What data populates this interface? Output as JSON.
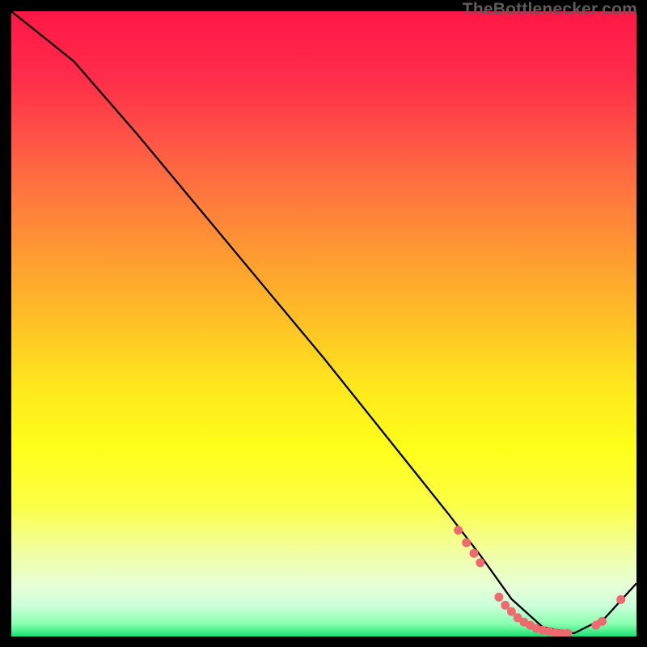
{
  "watermark": "TheBottlenecker.com",
  "chart_data": {
    "type": "line",
    "title": "",
    "xlabel": "",
    "ylabel": "",
    "xlim": [
      0,
      100
    ],
    "ylim": [
      0,
      100
    ],
    "series": [
      {
        "name": "bottleneck-curve",
        "x": [
          0,
          5,
          10,
          20,
          30,
          40,
          50,
          60,
          70,
          75,
          80,
          85,
          90,
          95,
          100
        ],
        "y": [
          100,
          96,
          92,
          80.5,
          68.5,
          56.5,
          44.5,
          32,
          19.5,
          13,
          6,
          1.5,
          0.5,
          3,
          8.5
        ]
      }
    ],
    "markers": {
      "name": "highlight-dots",
      "color": "#ee6a6e",
      "x": [
        71.5,
        72.8,
        74.0,
        75.0,
        78.0,
        79.0,
        80.0,
        81.0,
        82.0,
        83.0,
        84.0,
        85.0,
        86.0,
        87.0,
        88.0,
        89.0,
        93.5,
        94.5,
        97.5
      ],
      "y": [
        17.0,
        15.0,
        13.3,
        11.8,
        6.3,
        5.0,
        4.0,
        3.0,
        2.3,
        1.8,
        1.3,
        1.0,
        0.8,
        0.6,
        0.5,
        0.5,
        1.8,
        2.4,
        5.9
      ]
    },
    "background_gradient_note": "vertical red-to-green through orange/yellow"
  }
}
